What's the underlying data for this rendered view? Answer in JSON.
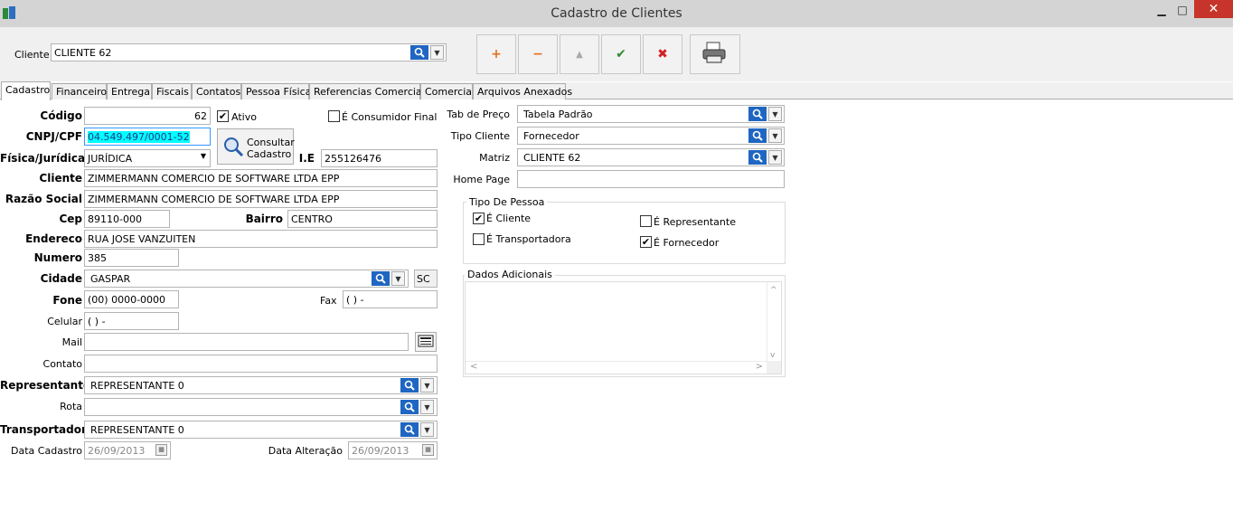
{
  "window": {
    "title": "Cadastro de Clientes",
    "minimize": "▁",
    "maximize": "□",
    "close": "✕"
  },
  "toolbar": {
    "cliente_label": "Cliente",
    "cliente_value": "CLIENTE 62",
    "add": "+",
    "remove": "−",
    "up": "▲",
    "confirm": "✔",
    "cancel": "✖"
  },
  "tabs": [
    "Cadastro",
    "Financeiro",
    "Entrega",
    "Fiscais",
    "Contatos",
    "Pessoa Física",
    "Referencias Comerciais",
    "Comercial",
    "Arquivos Anexados"
  ],
  "form": {
    "codigo_label": "Código",
    "codigo": "62",
    "ativo_label": "Ativo",
    "ativo_checked": "✔",
    "consumidor_label": "É Consumidor Final",
    "cnpj_label": "CNPJ/CPF",
    "cnpj": "04.549.497/0001-52",
    "consultar_line1": "Consultar",
    "consultar_line2": "Cadastro",
    "fisica_label": "Física/Jurídica",
    "fisica": "JURÍDICA",
    "ie_label": "I.E",
    "ie": "255126476",
    "cliente_label": "Cliente",
    "cliente": "ZIMMERMANN COMERCIO DE SOFTWARE LTDA EPP",
    "razao_label": "Razão Social",
    "razao": "ZIMMERMANN COMERCIO DE SOFTWARE LTDA EPP",
    "cep_label": "Cep",
    "cep": "89110-000",
    "bairro_label": "Bairro",
    "bairro": "CENTRO",
    "endereco_label": "Endereco",
    "endereco": "RUA JOSE VANZUITEN",
    "numero_label": "Numero",
    "numero": "385",
    "cidade_label": "Cidade",
    "cidade": "GASPAR",
    "uf": "SC",
    "fone_label": "Fone",
    "fone": "(00) 0000-0000",
    "fax_label": "Fax",
    "fax": "(  )     -",
    "celular_label": "Celular",
    "celular": "(  )     -",
    "mail_label": "Mail",
    "mail": "",
    "contato_label": "Contato",
    "contato": "",
    "representante_label": "Representante",
    "representante": "REPRESENTANTE 0",
    "rota_label": "Rota",
    "rota": "",
    "transportadora_label": "Transportadora",
    "transportadora": "REPRESENTANTE 0",
    "data_cadastro_label": "Data Cadastro",
    "data_cadastro": "26/09/2013",
    "data_alteracao_label": "Data Alteração",
    "data_alteracao": "26/09/2013"
  },
  "right": {
    "tab_preco_label": "Tab de Preço",
    "tab_preco": "Tabela Padrão",
    "tipo_cliente_label": "Tipo Cliente",
    "tipo_cliente": "Fornecedor",
    "matriz_label": "Matriz",
    "matriz": "CLIENTE 62",
    "home_page_label": "Home Page",
    "home_page": "",
    "tipo_pessoa_title": "Tipo De Pessoa",
    "e_cliente": "É Cliente",
    "e_cliente_checked": "✔",
    "e_representante": "É Representante",
    "e_transportadora": "É Transportadora",
    "e_fornecedor": "É Fornecedor",
    "e_fornecedor_checked": "✔",
    "dados_title": "Dados Adicionais"
  },
  "colors": {
    "accent": "#1f66c2",
    "highlight": "#00ffff",
    "close_red": "#c7342b",
    "add_orange": "#e2701f",
    "confirm_green": "#2f8a2f",
    "cancel_red": "#d42020"
  },
  "icons": [
    "search-icon",
    "chevron-down-icon",
    "printer-icon",
    "mail-icon",
    "calendar-icon",
    "app-icon"
  ]
}
